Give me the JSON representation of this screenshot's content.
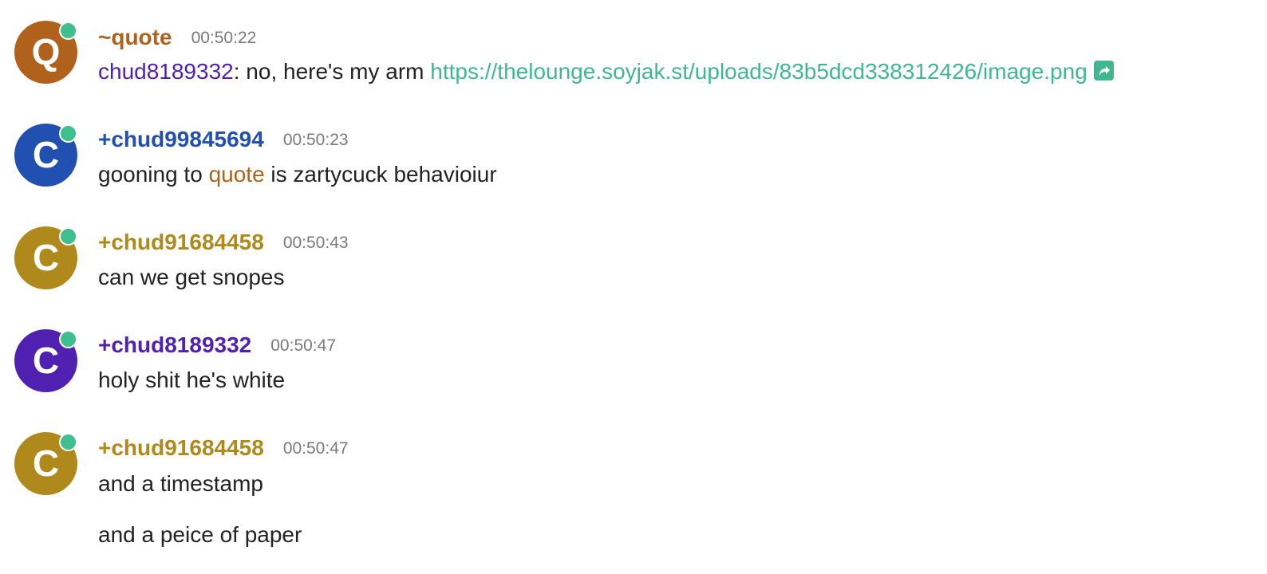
{
  "colors": {
    "quote": "#b0621d",
    "chud99845694": "#2150b0",
    "chud91684458": "#b0891d",
    "chud8189332": "#5021b0",
    "link": "#3fb890",
    "online": "#3fbf8f"
  },
  "messages": [
    {
      "avatar_letter": "Q",
      "nick": "~quote",
      "time": "00:50:22",
      "mention": "chud8189332",
      "text_after_mention": ": no, here's my arm ",
      "link": "https://thelounge.soyjak.st/uploads/83b5dcd338312426/image.png",
      "link_icon": "share-icon"
    },
    {
      "avatar_letter": "C",
      "nick": "+chud99845694",
      "time": "00:50:23",
      "text_before": "gooning to ",
      "mention": "quote",
      "text_after": " is zartycuck behavioiur"
    },
    {
      "avatar_letter": "C",
      "nick": "+chud91684458",
      "time": "00:50:43",
      "text": "can we get snopes"
    },
    {
      "avatar_letter": "C",
      "nick": "+chud8189332",
      "time": "00:50:47",
      "text": "holy shit he's white"
    },
    {
      "avatar_letter": "C",
      "nick": "+chud91684458",
      "time": "00:50:47",
      "text": "and a timestamp",
      "continuation": "and a peice of paper"
    }
  ]
}
